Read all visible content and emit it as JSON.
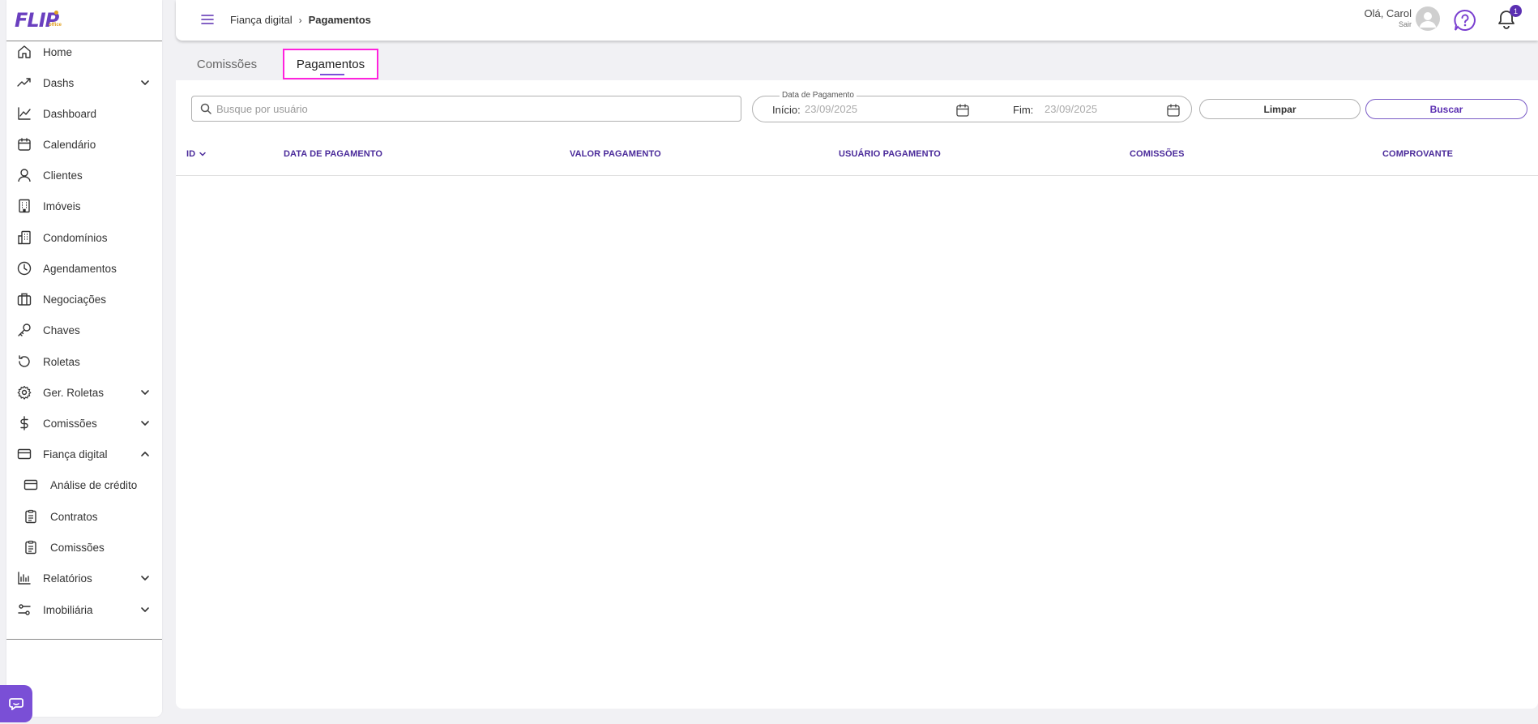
{
  "app": {
    "logo_text": "FLIP",
    "logo_sub": "office"
  },
  "sidebar": {
    "items": [
      {
        "label": "Home",
        "icon": "home-icon",
        "expandable": false
      },
      {
        "label": "Dashs",
        "icon": "trending-up-icon",
        "expandable": true
      },
      {
        "label": "Dashboard",
        "icon": "line-chart-icon",
        "expandable": false
      },
      {
        "label": "Calendário",
        "icon": "calendar-icon",
        "expandable": false
      },
      {
        "label": "Clientes",
        "icon": "user-icon",
        "expandable": false
      },
      {
        "label": "Imóveis",
        "icon": "building-icon",
        "expandable": false
      },
      {
        "label": "Condomínios",
        "icon": "buildings-icon",
        "expandable": false
      },
      {
        "label": "Agendamentos",
        "icon": "clock-icon",
        "expandable": false
      },
      {
        "label": "Negociações",
        "icon": "briefcase-icon",
        "expandable": false
      },
      {
        "label": "Chaves",
        "icon": "key-icon",
        "expandable": false
      },
      {
        "label": "Roletas",
        "icon": "rotate-icon",
        "expandable": false
      },
      {
        "label": "Ger. Roletas",
        "icon": "gear-icon",
        "expandable": true
      },
      {
        "label": "Comissões",
        "icon": "dollar-icon",
        "expandable": true
      },
      {
        "label": "Fiança digital",
        "icon": "credit-card-icon",
        "expandable": true,
        "expanded": true
      },
      {
        "label": "Análise de crédito",
        "icon": "credit-card-icon",
        "sub": true
      },
      {
        "label": "Contratos",
        "icon": "clipboard-icon",
        "sub": true
      },
      {
        "label": "Comissões",
        "icon": "clipboard-icon",
        "sub": true
      },
      {
        "label": "Relatórios",
        "icon": "bar-chart-icon",
        "expandable": true
      },
      {
        "label": "Imobiliária",
        "icon": "sliders-icon",
        "expandable": true
      }
    ]
  },
  "header": {
    "breadcrumb": [
      "Fiança digital",
      "Pagamentos"
    ],
    "greeting": "Olá, Carol",
    "logout": "Sair",
    "notification_count": "1"
  },
  "tabs": [
    {
      "label": "Comissões",
      "active": false
    },
    {
      "label": "Pagamentos",
      "active": true
    }
  ],
  "filters": {
    "search_placeholder": "Busque por usuário",
    "date_legend": "Data de Pagamento",
    "start_label": "Início:",
    "start_value": "23/09/2025",
    "end_label": "Fim:",
    "end_value": "23/09/2025",
    "clear_label": "Limpar",
    "search_label": "Buscar"
  },
  "table": {
    "columns": [
      "ID",
      "DATA DE PAGAMENTO",
      "VALOR PAGAMENTO",
      "USUÁRIO PAGAMENTO",
      "COMISSÕES",
      "COMPROVANTE"
    ],
    "rows": []
  },
  "colors": {
    "accent": "#5b2fb2",
    "highlight": "#ff22dd"
  }
}
